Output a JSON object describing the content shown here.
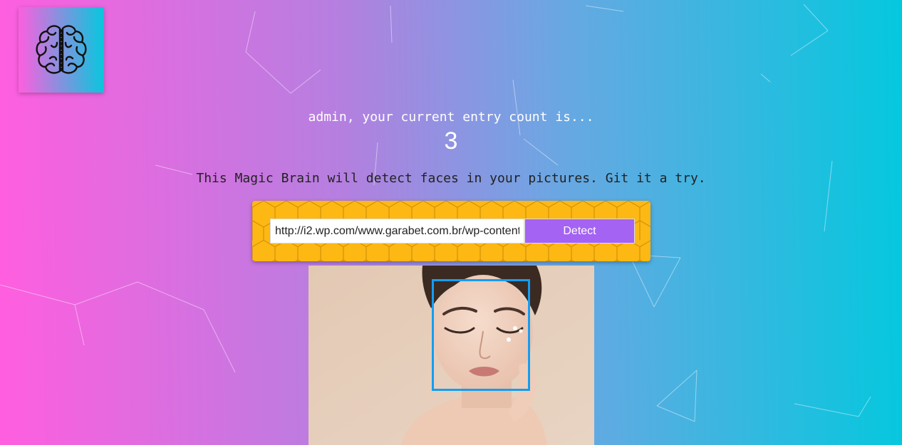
{
  "app": {
    "logo_icon": "brain-icon",
    "accent_color": "#a463f2",
    "panel_color": "#fdb813",
    "box_color": "#149df2"
  },
  "rank": {
    "greeting": "admin, your current entry count is...",
    "count": "3"
  },
  "intro": {
    "text": "This Magic Brain will detect faces in your pictures. Git it a try."
  },
  "form": {
    "url_value": "http://i2.wp.com/www.garabet.com.br/wp-content",
    "detect_label": "Detect"
  },
  "result": {
    "faces_detected": 1
  }
}
